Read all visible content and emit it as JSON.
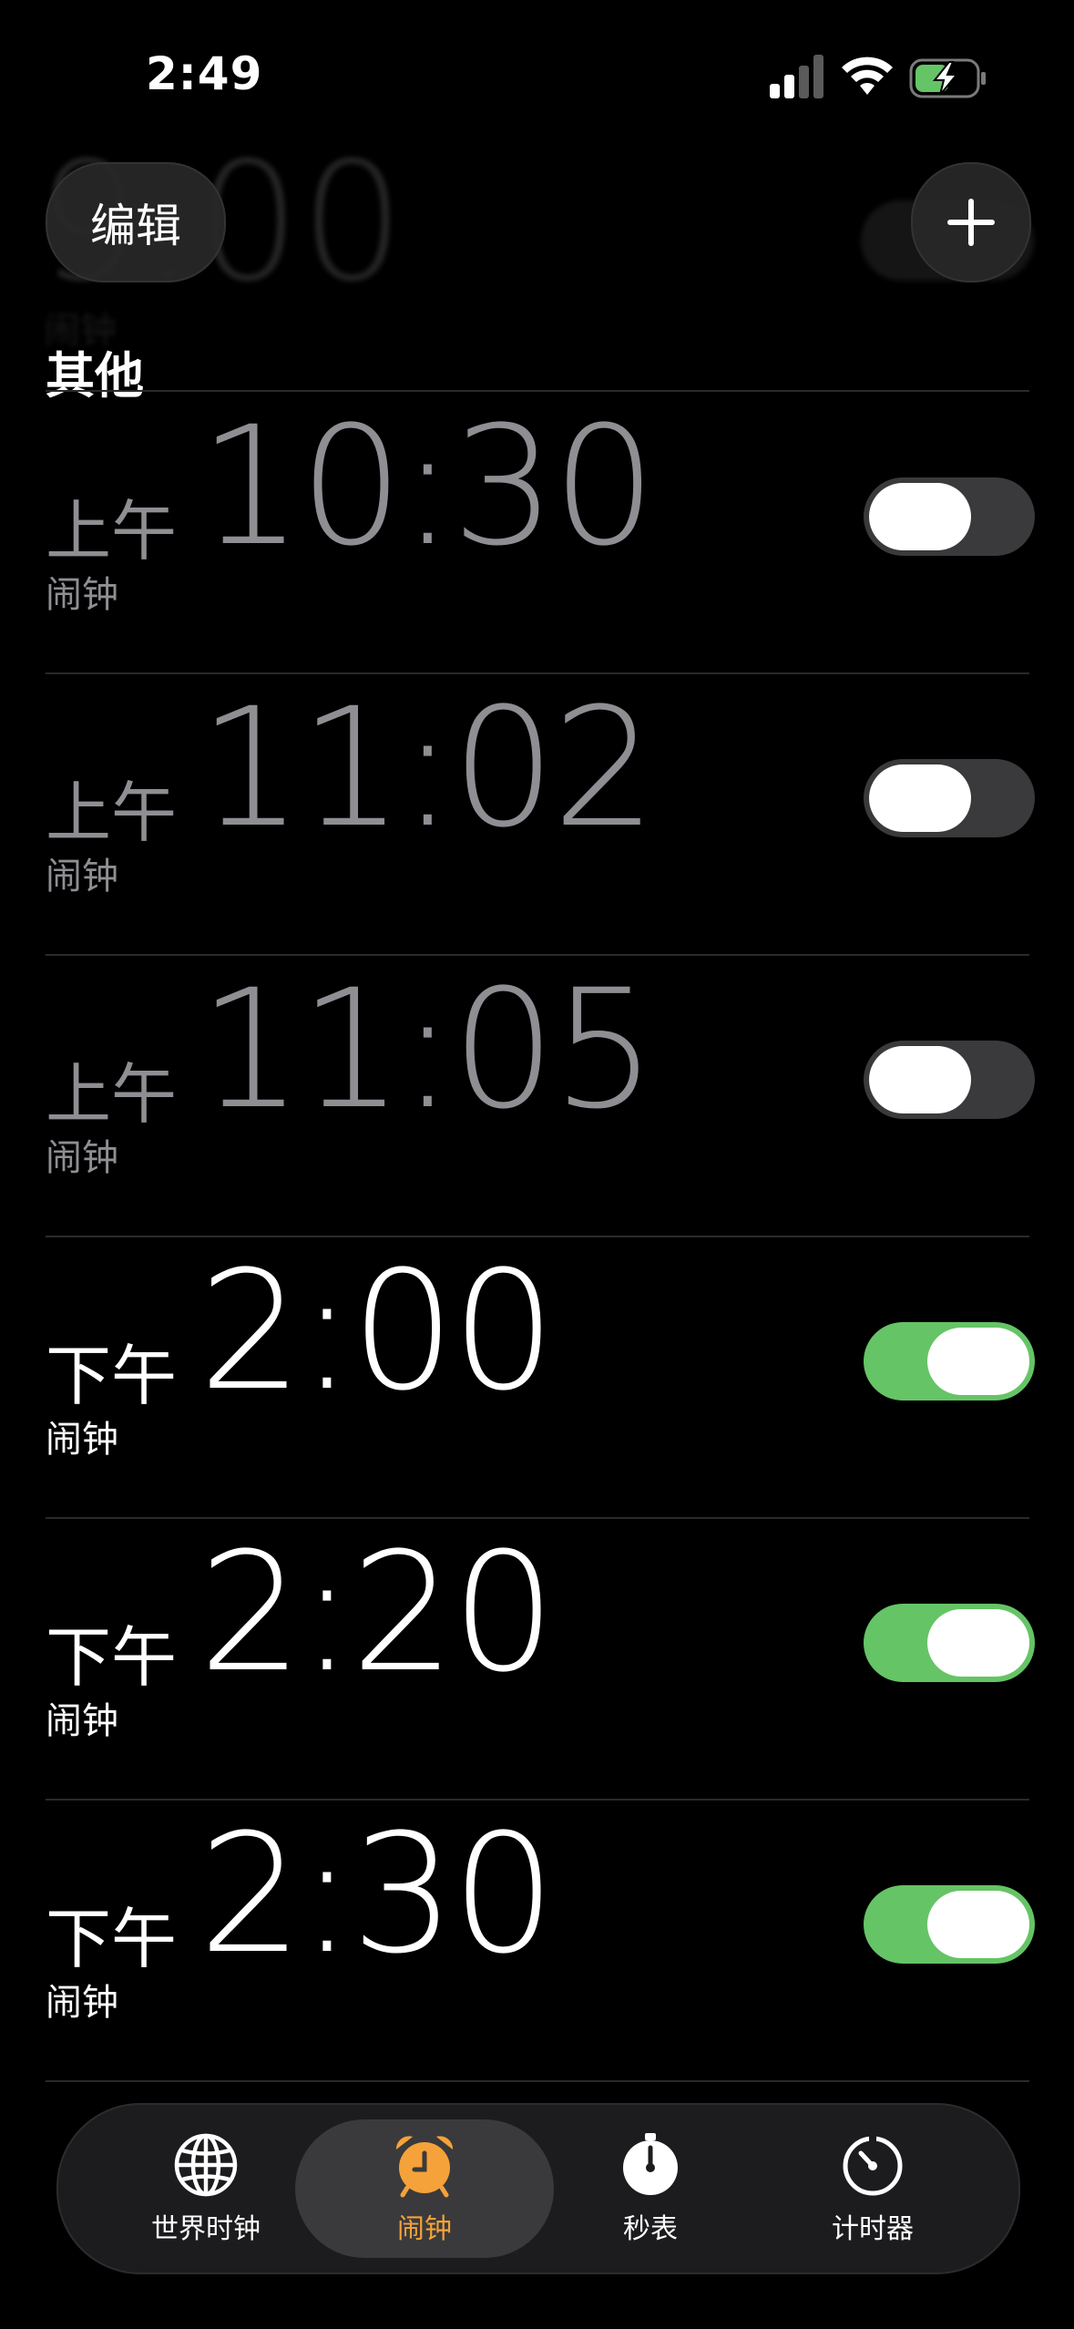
{
  "status_bar": {
    "time": "2:49"
  },
  "header": {
    "edit_label": "编辑",
    "ghost_time": "9:00",
    "ghost_label": "闹钟"
  },
  "section": {
    "title": "其他"
  },
  "alarms": [
    {
      "ampm": "上午",
      "time": "10:30",
      "label": "闹钟",
      "enabled": false
    },
    {
      "ampm": "上午",
      "time": "11:02",
      "label": "闹钟",
      "enabled": false
    },
    {
      "ampm": "上午",
      "time": "11:05",
      "label": "闹钟",
      "enabled": false
    },
    {
      "ampm": "下午",
      "time": "2:00",
      "label": "闹钟",
      "enabled": true
    },
    {
      "ampm": "下午",
      "time": "2:20",
      "label": "闹钟",
      "enabled": true
    },
    {
      "ampm": "下午",
      "time": "2:30",
      "label": "闹钟",
      "enabled": true
    }
  ],
  "tabs": [
    {
      "label": "世界时钟",
      "icon": "globe-icon",
      "active": false
    },
    {
      "label": "闹钟",
      "icon": "alarm-clock-icon",
      "active": true
    },
    {
      "label": "秒表",
      "icon": "stopwatch-icon",
      "active": false
    },
    {
      "label": "计时器",
      "icon": "timer-icon",
      "active": false
    }
  ],
  "colors": {
    "accent": "#f5a23a",
    "toggle_on": "#65c466",
    "toggle_off": "#3a3a3c",
    "dim_text": "#8e8e93"
  }
}
